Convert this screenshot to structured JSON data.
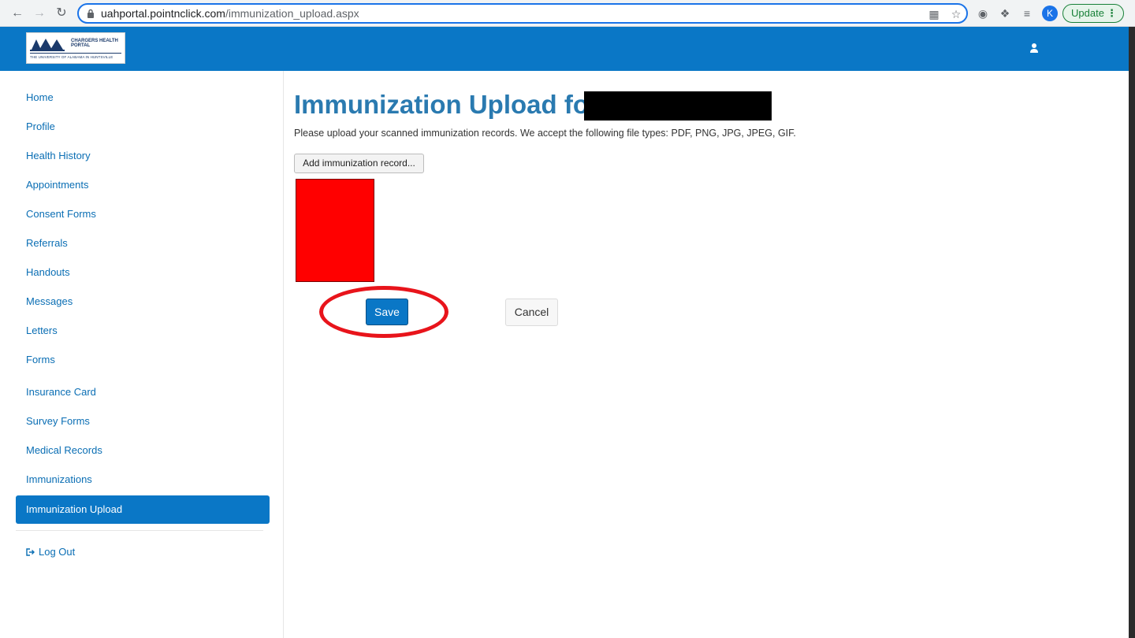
{
  "browser": {
    "url_host": "uahportal.pointnclick.com",
    "url_path": "/immunization_upload.aspx",
    "profile_initial": "K",
    "update_label": "Update"
  },
  "header": {
    "logo_title": "CHARGERS HEALTH PORTAL",
    "logo_subtitle": "THE UNIVERSITY OF ALABAMA IN HUNTSVILLE",
    "brand_color": "#0a77c6"
  },
  "sidebar": {
    "items": [
      {
        "label": "Home"
      },
      {
        "label": "Profile"
      },
      {
        "label": "Health History"
      },
      {
        "label": "Appointments"
      },
      {
        "label": "Consent Forms"
      },
      {
        "label": "Referrals"
      },
      {
        "label": "Handouts"
      },
      {
        "label": "Messages"
      },
      {
        "label": "Letters"
      },
      {
        "label": "Forms"
      },
      {
        "label": "Insurance Card"
      },
      {
        "label": "Survey Forms"
      },
      {
        "label": "Medical Records"
      },
      {
        "label": "Immunizations"
      },
      {
        "label": "Immunization Upload"
      }
    ],
    "active": "Immunization Upload",
    "logout_label": "Log Out"
  },
  "main": {
    "title": "Immunization Upload for",
    "instructions": "Please upload your scanned immunization records. We accept the following file types: PDF, PNG, JPG, JPEG, GIF.",
    "add_button": "Add immunization record...",
    "save_button": "Save",
    "cancel_button": "Cancel",
    "highlight_color": "#e8141b"
  }
}
